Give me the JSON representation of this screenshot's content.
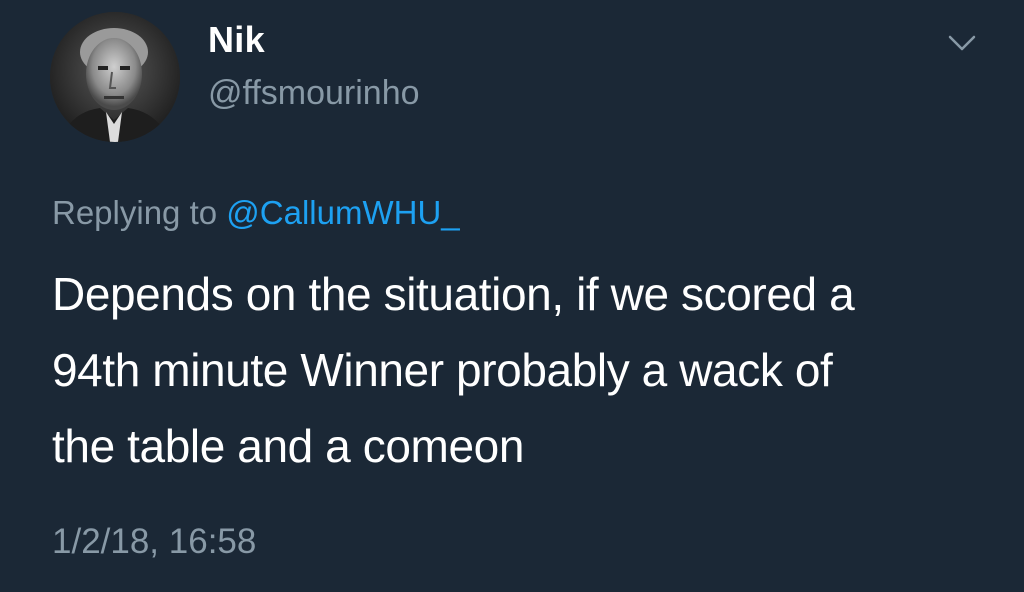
{
  "author": {
    "display_name": "Nik",
    "handle": "@ffsmourinho"
  },
  "menu": {
    "icon": "chevron-down-icon"
  },
  "reply": {
    "prefix": "Replying to",
    "mention": "@CallumWHU_"
  },
  "tweet": {
    "lines": [
      "Depends on the situation, if we scored a",
      "94th minute Winner probably a wack of",
      "the table and a comeon"
    ]
  },
  "timestamp": "1/2/18, 16:58",
  "colors": {
    "background": "#1b2836",
    "text": "#ffffff",
    "muted": "#8899a6",
    "link": "#1da1f2"
  }
}
